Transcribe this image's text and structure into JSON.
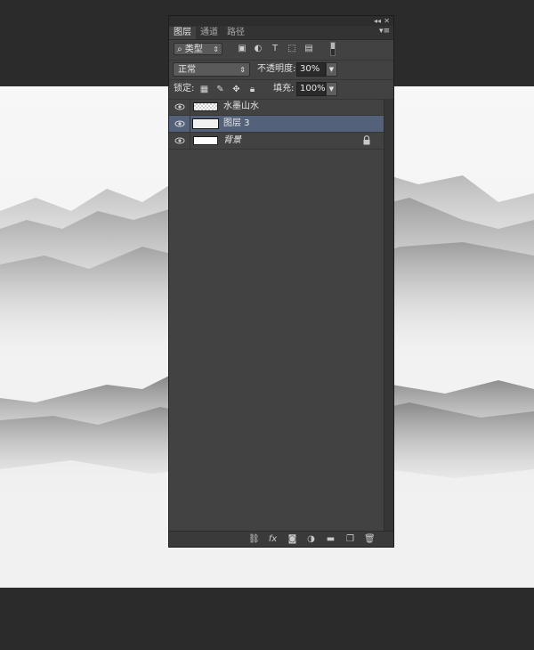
{
  "panel": {
    "tabs": [
      "图层",
      "通道",
      "路径"
    ],
    "active_tab": 0,
    "filter": {
      "kind_label": "类型",
      "icons": [
        "pixel-filter-icon",
        "adjustment-filter-icon",
        "type-filter-icon",
        "shape-filter-icon",
        "smartobject-filter-icon"
      ]
    },
    "blend": {
      "mode": "正常",
      "opacity_label": "不透明度:",
      "opacity": "30%"
    },
    "lock": {
      "label": "锁定:",
      "fill_label": "填充:",
      "fill": "100%"
    },
    "layers": [
      {
        "name": "水墨山水",
        "thumb": "checker",
        "selected": false,
        "italic": false,
        "locked": false
      },
      {
        "name": "图层 3",
        "thumb": "selthumb",
        "selected": true,
        "italic": false,
        "locked": false
      },
      {
        "name": "背景",
        "thumb": "white",
        "selected": false,
        "italic": true,
        "locked": true
      }
    ],
    "footer_icons": [
      "link-icon",
      "fx-icon",
      "mask-icon",
      "adjustment-icon",
      "folder-icon",
      "new-layer-icon",
      "trash-icon"
    ]
  },
  "colors": {
    "panel_bg": "#424242",
    "selection": "#53617a",
    "workspace": "#2b2b2b"
  }
}
